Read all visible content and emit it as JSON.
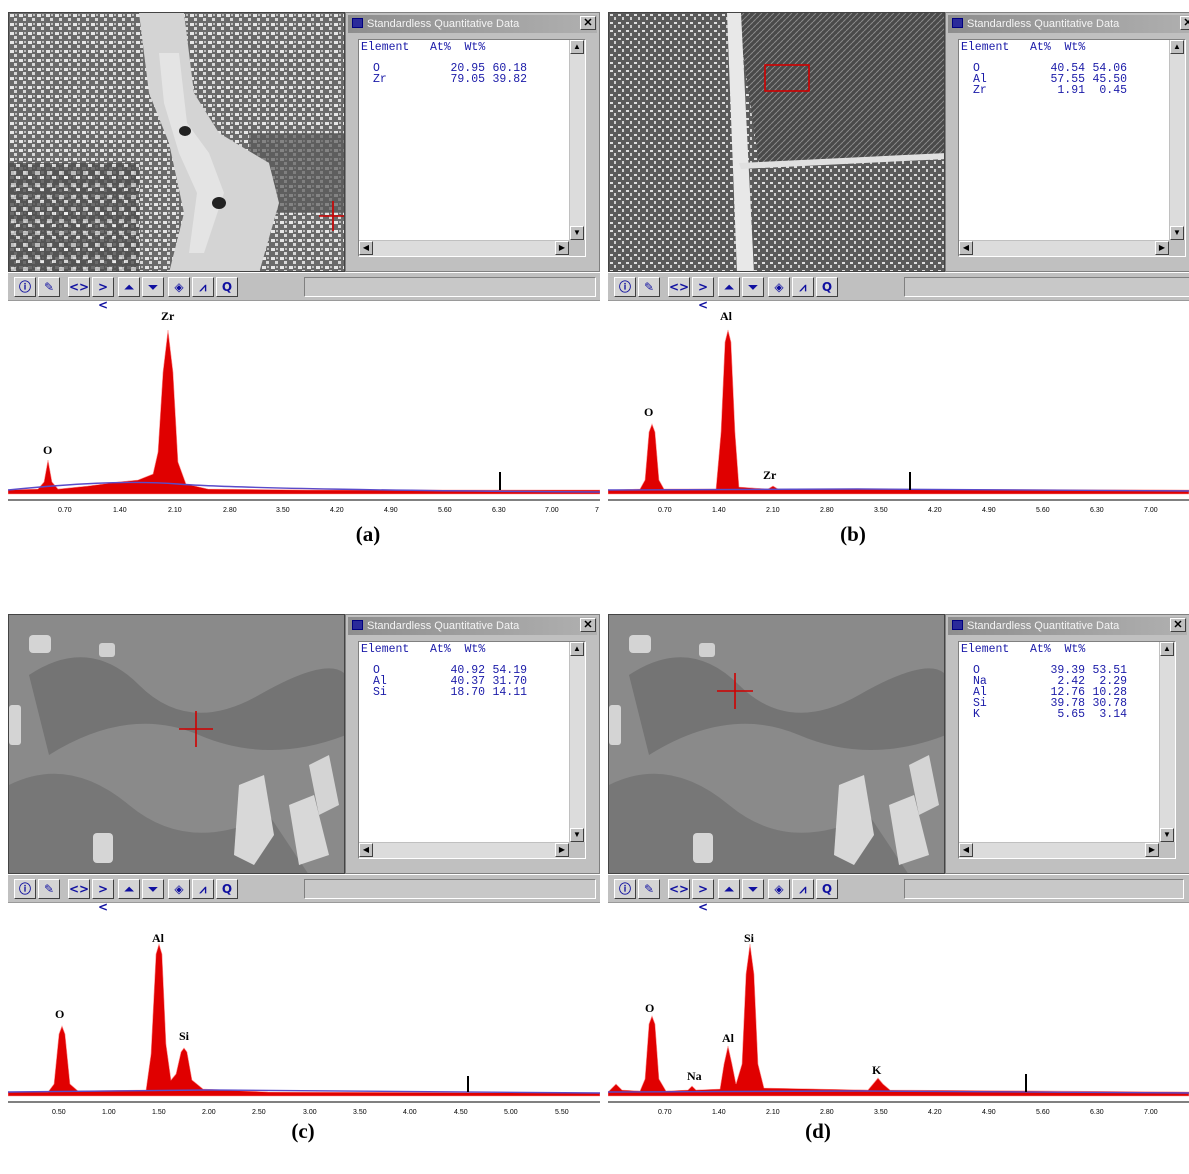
{
  "colors": {
    "spectrum_fill": "#e00000",
    "baseline": "#5a4bc9",
    "table_text": "#1a1aa8",
    "window_gray": "#c0c0c0"
  },
  "toolbar_icons": [
    "info-icon",
    "pencil-icon",
    "expand-icon",
    "collapse-icon",
    "triangle-up-icon",
    "triangle-down-icon",
    "layers-icon",
    "peaks-icon",
    "quantify-icon"
  ],
  "panels": [
    {
      "caption": "(a)",
      "window_title": "Standardless Quantitative Data",
      "table": {
        "header": "Element   At%  Wt%",
        "rows": [
          {
            "element": "O",
            "at": "20.95",
            "wt": "60.18"
          },
          {
            "element": "Zr",
            "at": "79.05",
            "wt": "39.82"
          }
        ]
      },
      "tick_labels": [
        "0.70",
        "1.40",
        "2.10",
        "2.80",
        "3.50",
        "4.20",
        "4.90",
        "5.60",
        "6.30",
        "7.00",
        "7"
      ],
      "peak_labels": [
        {
          "label": "Zr"
        },
        {
          "label": "O"
        }
      ]
    },
    {
      "caption": "(b)",
      "window_title": "Standardless Quantitative Data",
      "table": {
        "header": "Element   At%  Wt%",
        "rows": [
          {
            "element": "O",
            "at": "40.54",
            "wt": "54.06"
          },
          {
            "element": "Al",
            "at": "57.55",
            "wt": "45.50"
          },
          {
            "element": "Zr",
            "at": "1.91",
            "wt": "0.45"
          }
        ]
      },
      "tick_labels": [
        "0.70",
        "1.40",
        "2.10",
        "2.80",
        "3.50",
        "4.20",
        "4.90",
        "5.60",
        "6.30",
        "7.00"
      ],
      "peak_labels": [
        {
          "label": "Al"
        },
        {
          "label": "O"
        },
        {
          "label": "Zr"
        }
      ]
    },
    {
      "caption": "(c)",
      "window_title": "Standardless Quantitative Data",
      "table": {
        "header": "Element   At%  Wt%",
        "rows": [
          {
            "element": "O",
            "at": "40.92",
            "wt": "54.19"
          },
          {
            "element": "Al",
            "at": "40.37",
            "wt": "31.70"
          },
          {
            "element": "Si",
            "at": "18.70",
            "wt": "14.11"
          }
        ]
      },
      "tick_labels": [
        "0.50",
        "1.00",
        "1.50",
        "2.00",
        "2.50",
        "3.00",
        "3.50",
        "4.00",
        "4.50",
        "5.00",
        "5.50"
      ],
      "peak_labels": [
        {
          "label": "Al"
        },
        {
          "label": "O"
        },
        {
          "label": "Si"
        }
      ]
    },
    {
      "caption": "(d)",
      "window_title": "Standardless Quantitative Data",
      "table": {
        "header": "Element   At%  Wt%",
        "rows": [
          {
            "element": "O",
            "at": "39.39",
            "wt": "53.51"
          },
          {
            "element": "Na",
            "at": "2.42",
            "wt": "2.29"
          },
          {
            "element": "Al",
            "at": "12.76",
            "wt": "10.28"
          },
          {
            "element": "Si",
            "at": "39.78",
            "wt": "30.78"
          },
          {
            "element": "K",
            "at": "5.65",
            "wt": "3.14"
          }
        ]
      },
      "tick_labels": [
        "0.70",
        "1.40",
        "2.10",
        "2.80",
        "3.50",
        "4.20",
        "4.90",
        "5.60",
        "6.30",
        "7.00"
      ],
      "peak_labels": [
        {
          "label": "Si"
        },
        {
          "label": "O"
        },
        {
          "label": "Al"
        },
        {
          "label": "Na"
        },
        {
          "label": "K"
        }
      ]
    }
  ]
}
